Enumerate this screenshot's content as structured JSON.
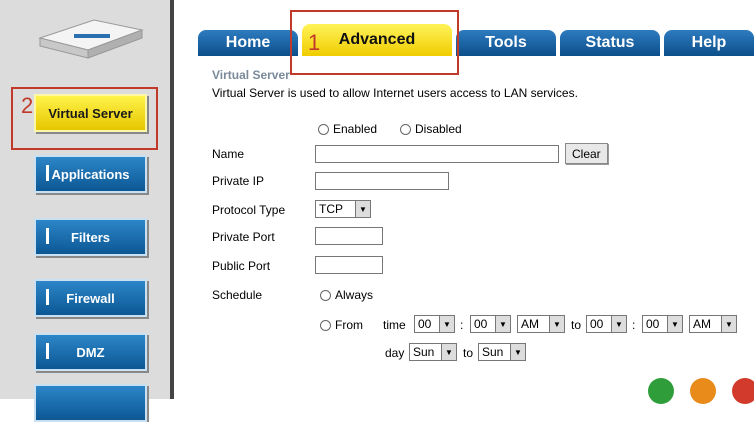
{
  "tabs": [
    {
      "label": "Home"
    },
    {
      "label": "Advanced"
    },
    {
      "label": "Tools"
    },
    {
      "label": "Status"
    },
    {
      "label": "Help"
    }
  ],
  "sidebar": {
    "items": [
      {
        "label": "Virtual Server"
      },
      {
        "label": "Applications"
      },
      {
        "label": "Filters"
      },
      {
        "label": "Firewall"
      },
      {
        "label": "DMZ"
      }
    ]
  },
  "section": {
    "title": "Virtual Server",
    "description": "Virtual Server is used to allow Internet users access to LAN services."
  },
  "form": {
    "enabled_label": "Enabled",
    "disabled_label": "Disabled",
    "name_label": "Name",
    "name_value": "",
    "clear_label": "Clear",
    "private_ip_label": "Private IP",
    "protocol_label": "Protocol Type",
    "protocol_value": "TCP",
    "private_port_label": "Private Port",
    "public_port_label": "Public Port",
    "schedule_label": "Schedule",
    "always_label": "Always",
    "from_label": "From",
    "time_label": "time",
    "to_label": "to",
    "day_label": "day",
    "time_from_hour": "00",
    "time_from_min": "00",
    "time_from_ampm": "AM",
    "time_to_hour": "00",
    "time_to_min": "00",
    "time_to_ampm": "AM",
    "day_from": "Sun",
    "day_to": "Sun",
    "colon": ":"
  },
  "annotations": {
    "one": "1",
    "two": "2"
  },
  "colors": {
    "tab_blue": "#0c4f8a",
    "tab_active": "#f0cc00",
    "annotation": "#c0392b"
  }
}
